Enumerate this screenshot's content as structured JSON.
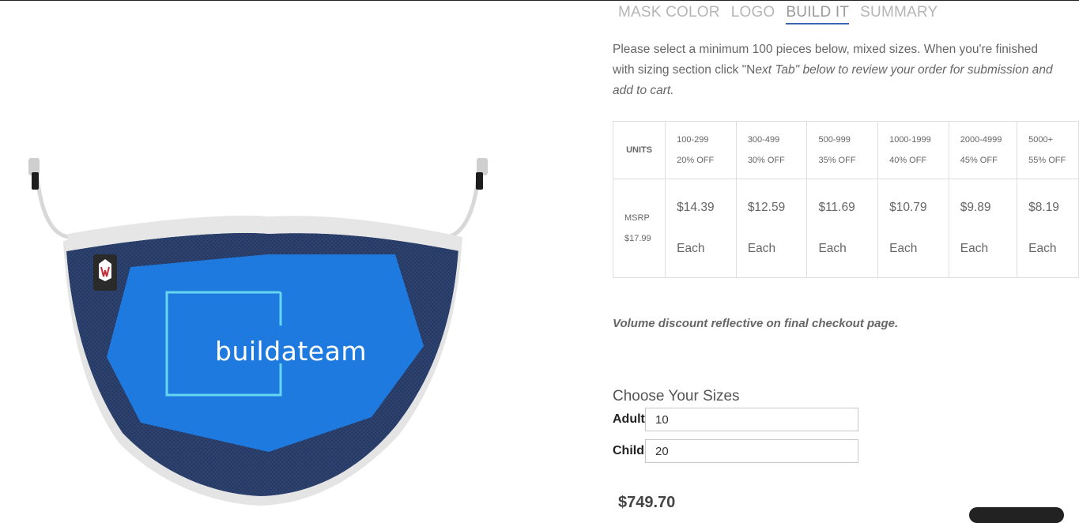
{
  "tabs": [
    {
      "label": "MASK COLOR",
      "active": false
    },
    {
      "label": "LOGO",
      "active": false
    },
    {
      "label": "BUILD IT",
      "active": true
    },
    {
      "label": "SUMMARY",
      "active": false
    }
  ],
  "intro": {
    "plain": "Please select a minimum 100 pieces below, mixed sizes. When you're finished with sizing section click \"N",
    "italic": "ext Tab\" below to review your order for submission and add to cart."
  },
  "pricing": {
    "units_label": "UNITS",
    "msrp_label": "MSRP",
    "msrp_value": "$17.99",
    "tiers": [
      {
        "range": "100-299",
        "discount": "20% OFF",
        "price": "$14.39",
        "unit": "Each"
      },
      {
        "range": "300-499",
        "discount": "30% OFF",
        "price": "$12.59",
        "unit": "Each"
      },
      {
        "range": "500-999",
        "discount": "35% OFF",
        "price": "$11.69",
        "unit": "Each"
      },
      {
        "range": "1000-1999",
        "discount": "40% OFF",
        "price": "$10.79",
        "unit": "Each"
      },
      {
        "range": "2000-4999",
        "discount": "45% OFF",
        "price": "$9.89",
        "unit": "Each"
      },
      {
        "range": "5000+",
        "discount": "55% OFF",
        "price": "$8.19",
        "unit": "Each"
      }
    ]
  },
  "note": "Volume discount reflective on final checkout page.",
  "sizes": {
    "title": "Choose Your Sizes",
    "adult_label": "Adult",
    "adult_value": "10",
    "child_label": "Child",
    "child_value": "20"
  },
  "total": "$749.70",
  "product": {
    "logo_text": "buildateam",
    "mask_color": "#24375f",
    "print_color": "#1f7ae0",
    "trim_color": "#e4e4e4"
  }
}
